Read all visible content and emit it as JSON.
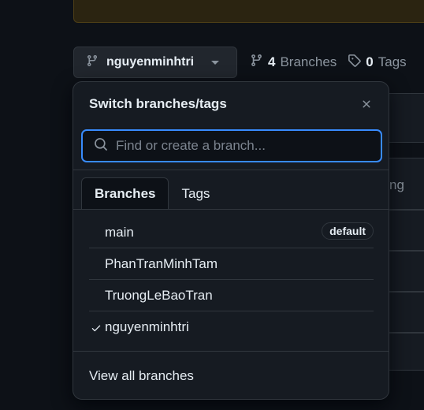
{
  "header": {
    "branch_button_label": "nguyenminhtri",
    "branches_count": "4",
    "branches_label": "Branches",
    "tags_count": "0",
    "tags_label": "Tags"
  },
  "background": {
    "partial_text": "ng"
  },
  "popover": {
    "title": "Switch branches/tags",
    "search_placeholder": "Find or create a branch...",
    "tabs": [
      {
        "label": "Branches"
      },
      {
        "label": "Tags"
      }
    ],
    "branches": [
      {
        "name": "main",
        "badge": "default"
      },
      {
        "name": "PhanTranMinhTam"
      },
      {
        "name": "TruongLeBaoTran"
      },
      {
        "name": "nguyenminhtri",
        "selected": true
      }
    ],
    "footer_link": "View all branches"
  },
  "colors": {
    "accent": "#388bfd",
    "background": "#0d1117",
    "surface": "#161b22",
    "border": "#30363d"
  }
}
